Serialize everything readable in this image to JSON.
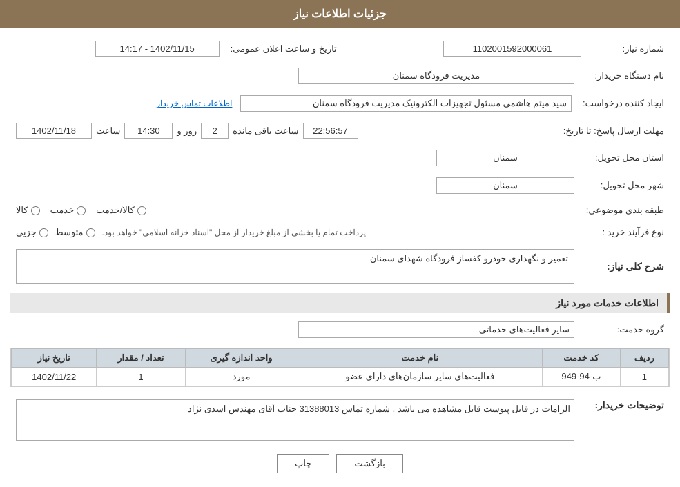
{
  "header": {
    "title": "جزئیات اطلاعات نیاز"
  },
  "fields": {
    "shomara_niaz_label": "شماره نیاز:",
    "shomara_niaz_value": "1102001592000061",
    "nam_dastgah_label": "نام دستگاه خریدار:",
    "nam_dastgah_value": "مدیریت فرودگاه سمنان",
    "ijad_konande_label": "ایجاد کننده درخواست:",
    "ijad_konande_value": "سید میثم هاشمی مسئول تجهیزات الکترونیک مدیریت فرودگاه سمنان",
    "ijad_konande_link": "اطلاعات تماس خریدار",
    "mohlat_label": "مهلت ارسال پاسخ: تا تاریخ:",
    "tarikh_value": "1402/11/18",
    "saat_label": "ساعت",
    "saat_value": "14:30",
    "rooz_label": "روز و",
    "rooz_value": "2",
    "baqi_label": "ساعت باقی مانده",
    "baqi_value": "22:56:57",
    "tarikh_elam_label": "تاریخ و ساعت اعلان عمومی:",
    "tarikh_elam_value": "1402/11/15 - 14:17",
    "ostan_label": "استان محل تحویل:",
    "ostan_value": "سمنان",
    "shahr_label": "شهر محل تحویل:",
    "shahr_value": "سمنان",
    "tabaqe_label": "طبقه بندی موضوعی:",
    "kala_label": "کالا",
    "khadamat_label": "خدمت",
    "kala_khadamat_label": "کالا/خدمت",
    "navea_label": "نوع فرآیند خرید :",
    "jozei_label": "جزیی",
    "motavasset_label": "متوسط",
    "notice_text": "پرداخت تمام یا بخشی از مبلغ خریدار از محل \"اسناد خزانه اسلامی\" خواهد بود.",
    "sharh_niaz_label": "شرح کلی نیاز:",
    "sharh_niaz_value": "تعمیر و نگهداری خودرو کفساز فرودگاه شهدای سمنان",
    "khadamat_info_label": "اطلاعات خدمات مورد نیاز",
    "gorohe_khadamat_label": "گروه خدمت:",
    "gorohe_khadamat_value": "سایر فعالیت‌های خدماتی"
  },
  "table": {
    "headers": [
      "ردیف",
      "کد خدمت",
      "نام خدمت",
      "واحد اندازه گیری",
      "تعداد / مقدار",
      "تاریخ نیاز"
    ],
    "rows": [
      {
        "radif": "1",
        "kod_khadamat": "ب-94-949",
        "nam_khadamat": "فعالیت‌های سایر سازمان‌های دارای عضو",
        "vahed": "مورد",
        "tedad": "1",
        "tarikh": "1402/11/22"
      }
    ]
  },
  "tawzihat": {
    "label": "توضیحات خریدار:",
    "value": "الزامات در فایل پیوست قابل مشاهده می باشد . شماره تماس 31388013 جناب آقای مهندس اسدی نژاد"
  },
  "buttons": {
    "chap": "چاپ",
    "bazgasht": "بازگشت"
  }
}
